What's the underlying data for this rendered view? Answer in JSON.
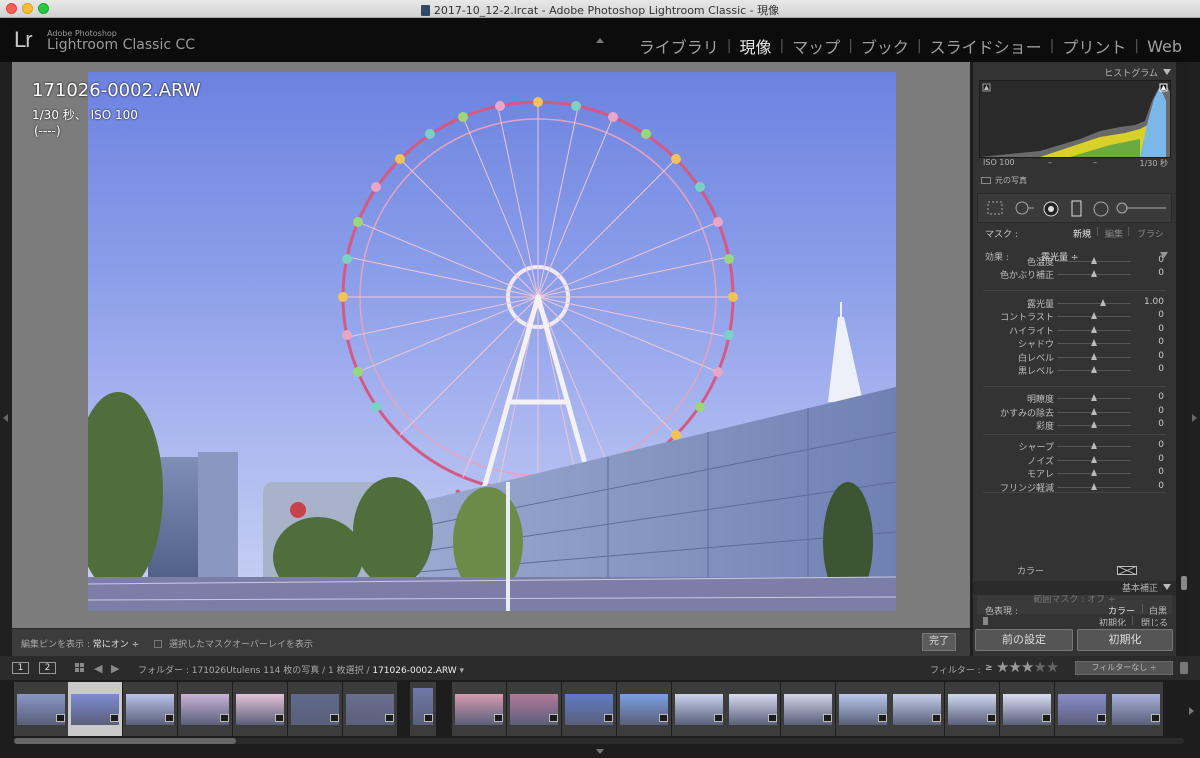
{
  "window": {
    "title": "2017-10_12-2.lrcat - Adobe Photoshop Lightroom Classic - 現像"
  },
  "brand": {
    "logo": "Lr",
    "small": "Adobe Photoshop",
    "big": "Lightroom Classic CC"
  },
  "modules": [
    {
      "label": "ライブラリ",
      "active": false
    },
    {
      "label": "現像",
      "active": true
    },
    {
      "label": "マップ",
      "active": false
    },
    {
      "label": "ブック",
      "active": false
    },
    {
      "label": "スライドショー",
      "active": false
    },
    {
      "label": "プリント",
      "active": false
    },
    {
      "label": "Web",
      "active": false
    }
  ],
  "photo_info": {
    "filename": "171026-0002.ARW",
    "exposure": "1/30 秒、 ISO 100",
    "lens": "(----)"
  },
  "toolbar": {
    "pin_label": "編集ピンを表示 : ",
    "pin_value": "常にオン ÷",
    "overlay_label": "選択したマスクオーバーレイを表示",
    "done": "完了"
  },
  "panel": {
    "histogram_title": "ヒストグラム",
    "histogram_iso": "ISO 100",
    "histogram_dash1": "–",
    "histogram_dash2": "–",
    "histogram_shutter": "1/30 秒",
    "original_photo": "元の写真",
    "mask_label": "マスク :",
    "mask_new": "新規",
    "mask_edit": "編集",
    "mask_brush": "ブラシ",
    "effect_label": "効果 :",
    "effect_value": "露光量 ÷",
    "rows": [
      {
        "label": "色温度",
        "value": "0",
        "pos": 0.5,
        "track": "temp"
      },
      {
        "label": "色かぶり補正",
        "value": "0",
        "pos": 0.5,
        "track": "tint"
      },
      {
        "label": "露光量",
        "value": "1.00",
        "pos": 0.62,
        "track": "plain"
      },
      {
        "label": "コントラスト",
        "value": "0",
        "pos": 0.5,
        "track": "plain"
      },
      {
        "label": "ハイライト",
        "value": "0",
        "pos": 0.5,
        "track": "plain"
      },
      {
        "label": "シャドウ",
        "value": "0",
        "pos": 0.5,
        "track": "plain"
      },
      {
        "label": "白レベル",
        "value": "0",
        "pos": 0.5,
        "track": "plain"
      },
      {
        "label": "黒レベル",
        "value": "0",
        "pos": 0.5,
        "track": "plain"
      },
      {
        "label": "明瞭度",
        "value": "0",
        "pos": 0.5,
        "track": "plain"
      },
      {
        "label": "かすみの除去",
        "value": "0",
        "pos": 0.5,
        "track": "plain"
      },
      {
        "label": "彩度",
        "value": "0",
        "pos": 0.5,
        "track": "sat"
      },
      {
        "label": "シャープ",
        "value": "0",
        "pos": 0.5,
        "track": "plain"
      },
      {
        "label": "ノイズ",
        "value": "0",
        "pos": 0.5,
        "track": "plain"
      },
      {
        "label": "モアレ",
        "value": "0",
        "pos": 0.5,
        "track": "plain"
      },
      {
        "label": "フリンジ軽減",
        "value": "0",
        "pos": 0.5,
        "track": "plain"
      }
    ],
    "color_label": "カラー",
    "range_mask": "範囲マスク : オフ ÷",
    "reset": "初期化",
    "close": "閉じる",
    "basic_title": "基本補正",
    "treatment_label": "色表現 :",
    "treatment_color": "カラー",
    "treatment_bw": "白黒",
    "prev_button": "前の設定",
    "reset_button": "初期化"
  },
  "filmbar": {
    "view1": "1",
    "view2": "2",
    "folder_prefix": "フォルダー : 171026Utulens   114 枚の写真 / 1 枚選択 / ",
    "current_file": "171026-0002.ARW",
    "filter_label": "フィルター :",
    "filter_op": "≥",
    "stars": 3,
    "filter_select": "フィルターなし ÷"
  },
  "colors": {
    "accent": "#e8e8e8",
    "panel_bg": "#333333",
    "canvas_bg": "#7c7c7c"
  }
}
